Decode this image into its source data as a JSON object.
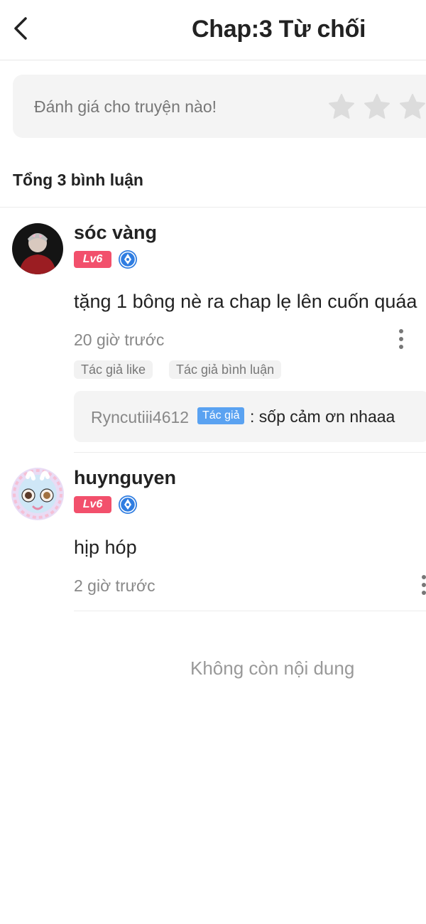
{
  "header": {
    "back_icon": "chevron-left-icon",
    "title": "Chap:3 Từ chối"
  },
  "rating": {
    "prompt": "Đánh giá cho truyện nào!",
    "star_icon": "star-icon",
    "star_color": "#dcdcdc",
    "stars_visible": 3
  },
  "summary": {
    "total_label": "Tổng 3 bình luận"
  },
  "comments": [
    {
      "username": "sóc vàng",
      "level": "Lv6",
      "badge_icon": "pen-nib-icon",
      "text": "tặng 1 bông nè ra chap lẹ lên cuốn quáa",
      "time": "20 giờ trước",
      "tags": [
        "Tác giả like",
        "Tác giả bình luận"
      ],
      "reply": {
        "username": "Ryncutiii4612",
        "author_tag": "Tác giả",
        "separator": ":",
        "text": "sốp cảm ơn nhaaa"
      }
    },
    {
      "username": "huynguyen",
      "level": "Lv6",
      "badge_icon": "pen-nib-icon",
      "text": "hịp hóp",
      "time": "2 giờ trước"
    }
  ],
  "footer": {
    "end_text": "Không còn nội dung"
  },
  "colors": {
    "level_badge": "#f2506c",
    "author_tag": "#5aa2f1",
    "pen_badge": "#2f7de1"
  }
}
